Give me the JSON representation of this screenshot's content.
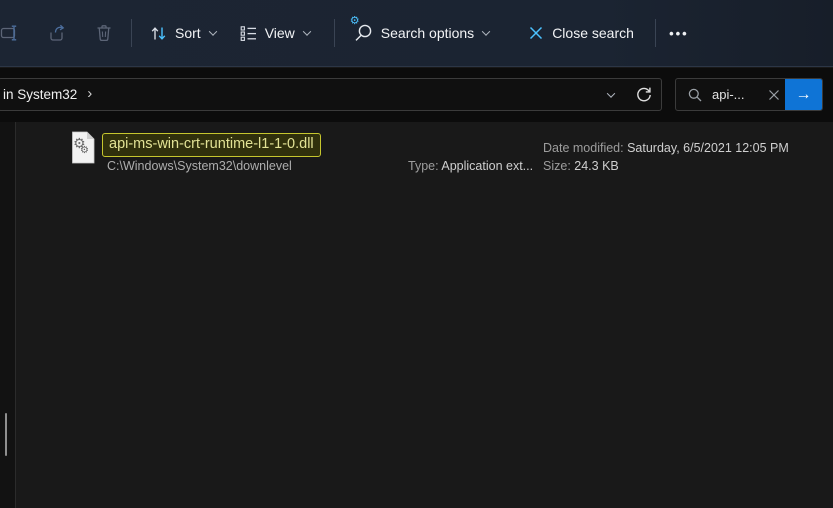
{
  "toolbar": {
    "sort": {
      "label": "Sort"
    },
    "view": {
      "label": "View"
    },
    "search_options": {
      "label": "Search options"
    },
    "close_search": {
      "label": "Close search"
    }
  },
  "glyphs": {
    "ellipsis": "•••",
    "gear": "⚙",
    "submit_arrow": "→",
    "breadcrumb_chevron": "›"
  },
  "address_bar": {
    "breadcrumb": "in System32"
  },
  "search_box": {
    "query": "api-..."
  },
  "results": [
    {
      "name": "api-ms-win-crt-runtime-l1-1-0.dll",
      "path": "C:\\Windows\\System32\\downlevel",
      "type_label": "Type:",
      "type_value": "Application ext...",
      "date_label": "Date modified:",
      "date_value": "Saturday, 6/5/2021 12:05 PM",
      "size_label": "Size:",
      "size_value": "24.3 KB"
    }
  ],
  "colors": {
    "toolbar_bg": "#1b2432",
    "accent_blue": "#0f74d6",
    "icon_blue": "#4cc2ff",
    "highlight_border": "#c6c62e",
    "highlight_bg": "#30300c",
    "highlight_text": "#e2e295",
    "content_bg": "#191919"
  }
}
